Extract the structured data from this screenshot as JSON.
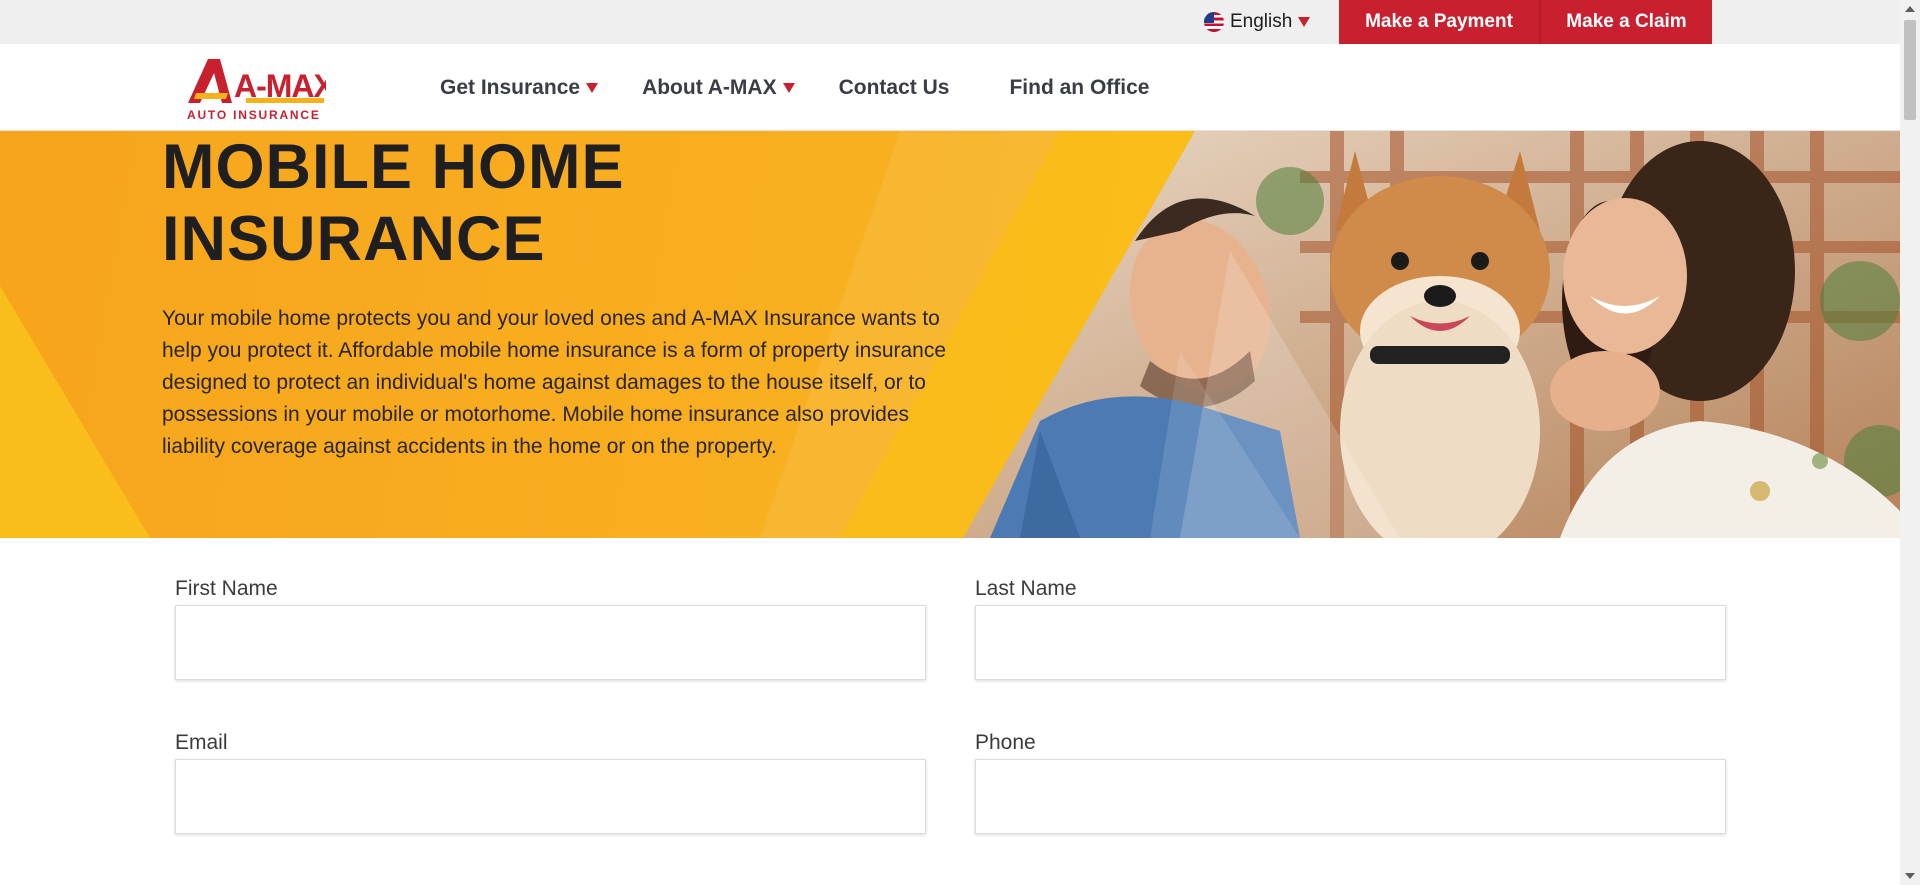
{
  "topbar": {
    "language": "English",
    "payment_label": "Make a Payment",
    "claim_label": "Make a Claim"
  },
  "logo": {
    "brand": "A-MAX",
    "tagline": "AUTO INSURANCE"
  },
  "nav": {
    "items": [
      {
        "label": "Get Insurance"
      },
      {
        "label": "About A-MAX"
      },
      {
        "label": "Contact Us"
      },
      {
        "label": "Find an Office"
      }
    ]
  },
  "hero": {
    "title_line1": "MOBILE HOME",
    "title_line2": "INSURANCE",
    "description": "Your mobile home protects you and your loved ones and A-MAX Insurance wants to help you protect it. Affordable mobile home insurance is a form of property insurance designed to protect an individual's home against damages to the house itself, or to possessions in your mobile or motorhome. Mobile home insurance also provides liability coverage against accidents in the home or on the property."
  },
  "form": {
    "first_name_label": "First Name",
    "last_name_label": "Last Name",
    "email_label": "Email",
    "phone_label": "Phone"
  },
  "colors": {
    "brand_red": "#c8202f",
    "hero_orange": "#f7a51c",
    "hero_yellow": "#fbbc15"
  }
}
